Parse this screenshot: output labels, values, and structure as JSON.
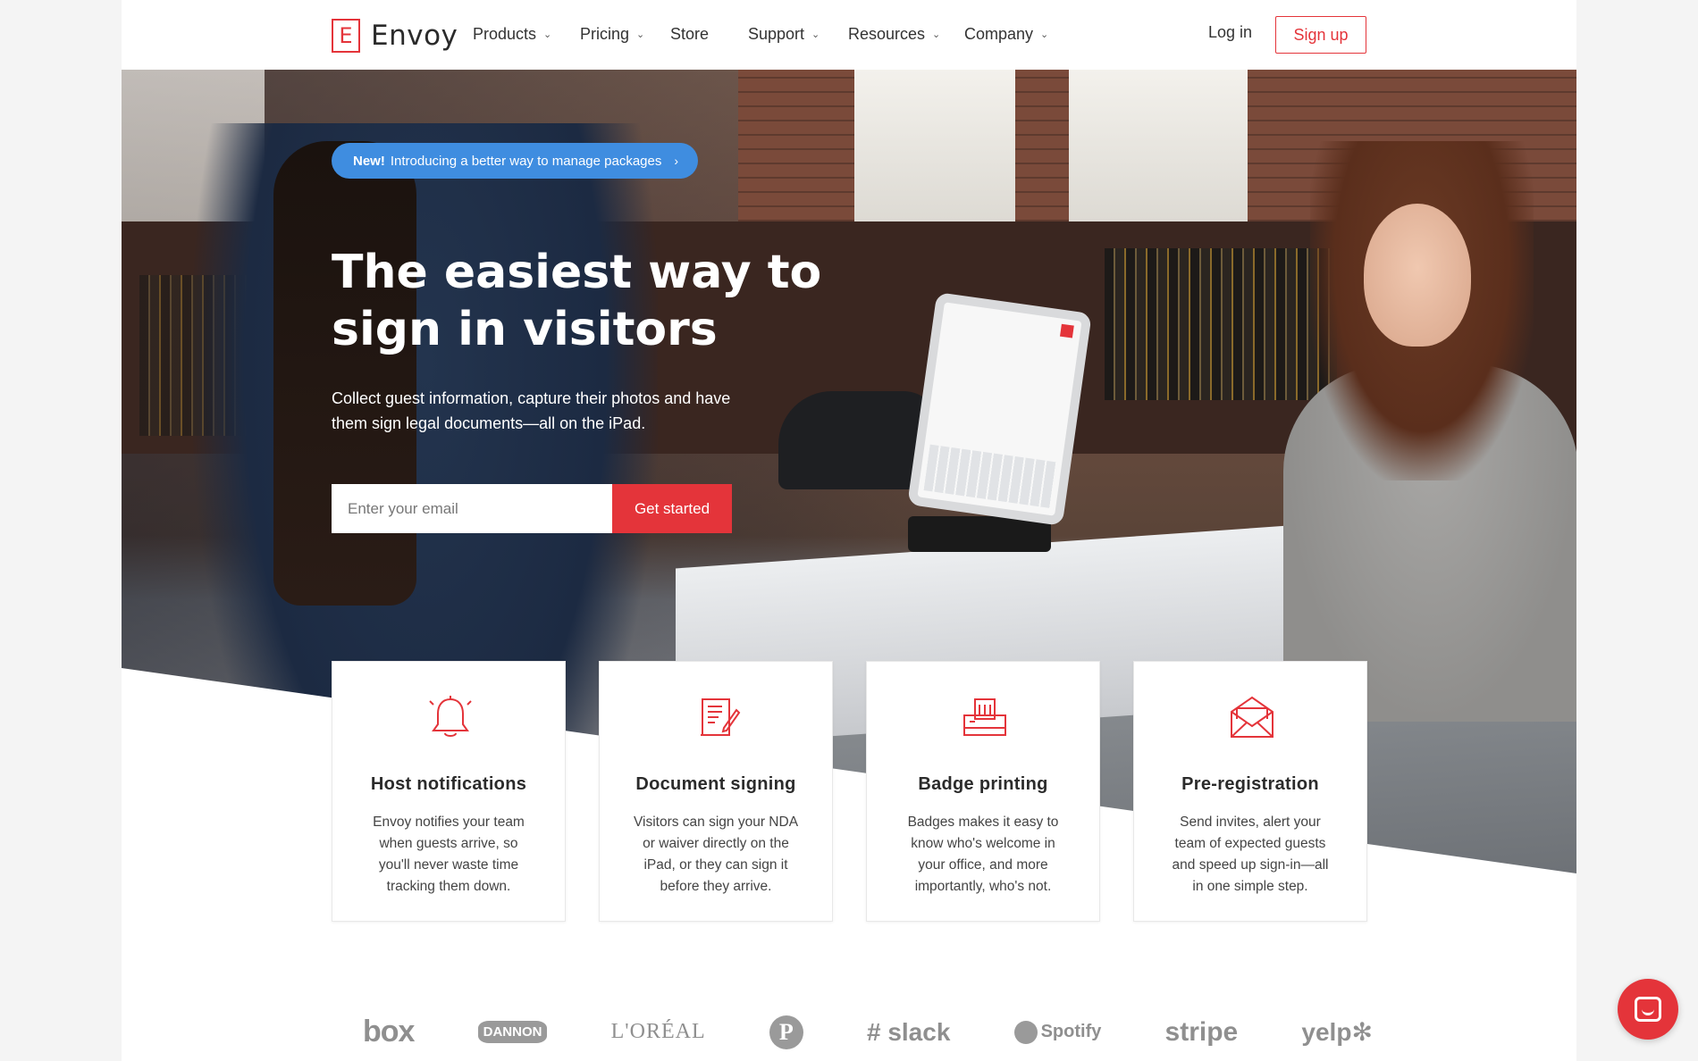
{
  "brand": {
    "name": "Envoy",
    "logo_letter": "E",
    "accent": "#e4343a",
    "banner_blue": "#3f8de0"
  },
  "nav": {
    "items": [
      {
        "label": "Products",
        "has_dropdown": true
      },
      {
        "label": "Pricing",
        "has_dropdown": true
      },
      {
        "label": "Store",
        "has_dropdown": false
      },
      {
        "label": "Support",
        "has_dropdown": true
      },
      {
        "label": "Resources",
        "has_dropdown": true
      },
      {
        "label": "Company",
        "has_dropdown": true
      }
    ],
    "chevron": "⌄",
    "login": "Log in",
    "signup": "Sign up"
  },
  "hero": {
    "banner_strong": "New!",
    "banner_text": "Introducing a better way to manage packages",
    "banner_arrow": "›",
    "headline": "The easiest way to sign in visitors",
    "subcopy": "Collect guest information, capture their photos and have them sign legal documents—all on the iPad.",
    "email_placeholder": "Enter your email",
    "cta": "Get started"
  },
  "features": [
    {
      "icon": "bell-icon",
      "title": "Host notifications",
      "text": "Envoy notifies your team when guests arrive, so you'll never waste time tracking them down."
    },
    {
      "icon": "document-pen-icon",
      "title": "Document signing",
      "text": "Visitors can sign your NDA or waiver directly on the iPad, or they can sign it before they arrive."
    },
    {
      "icon": "badge-printer-icon",
      "title": "Badge printing",
      "text": "Badges makes it easy to know who's welcome in your office, and more importantly, who's not."
    },
    {
      "icon": "envelope-icon",
      "title": "Pre-registration",
      "text": "Send invites, alert your team of expected guests and speed up sign-in—all in one simple step."
    }
  ],
  "customer_logos": [
    "box",
    "DANNON",
    "L'ORÉAL",
    "P",
    "slack",
    "Spotify",
    "stripe",
    "yelp"
  ],
  "chat": {
    "icon": "chat-bubble-icon"
  }
}
